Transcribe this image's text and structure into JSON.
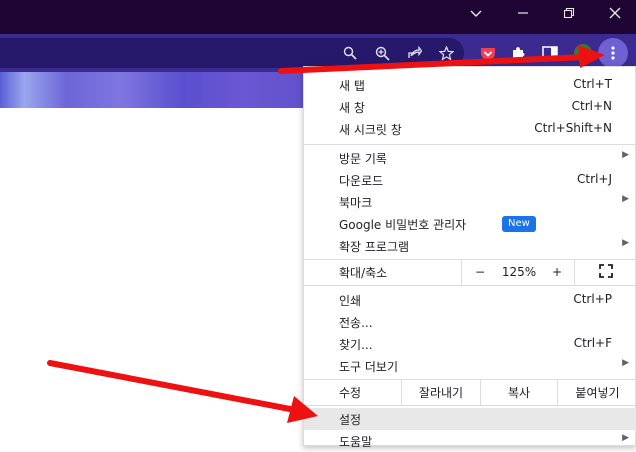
{
  "window_controls": [
    {
      "name": "tab-search",
      "icon": "chevron-down-icon",
      "glyph": "⌵"
    },
    {
      "name": "minimize",
      "icon": "minimize-icon",
      "glyph": "—"
    },
    {
      "name": "restore",
      "icon": "restore-icon",
      "glyph": "❐"
    },
    {
      "name": "close",
      "icon": "close-icon",
      "glyph": "✕"
    }
  ],
  "colors": {
    "titlebar": "#1f0533",
    "toolbar": "#3b2a8f",
    "omnibox": "#26186a",
    "accent_blue": "#1a73e8",
    "arrow_red": "#ee1111",
    "highlight": "#e8e8e9"
  },
  "menu": {
    "group1": [
      {
        "label": "새 탭",
        "shortcut": "Ctrl+T"
      },
      {
        "label": "새 창",
        "shortcut": "Ctrl+N"
      },
      {
        "label": "새 시크릿 창",
        "shortcut": "Ctrl+Shift+N"
      }
    ],
    "group2": [
      {
        "label": "방문 기록",
        "shortcut": "",
        "submenu": "▶"
      },
      {
        "label": "다운로드",
        "shortcut": "Ctrl+J"
      },
      {
        "label": "북마크",
        "shortcut": "",
        "submenu": "▶"
      },
      {
        "label": "Google 비밀번호 관리자",
        "shortcut": "",
        "badge": "New"
      },
      {
        "label": "확장 프로그램",
        "shortcut": "",
        "submenu": "▶"
      }
    ],
    "zoom": {
      "label": "확대/축소",
      "minus": "−",
      "value": "125%",
      "plus": "+",
      "fullscreen": "⛶"
    },
    "group3": [
      {
        "label": "인쇄",
        "shortcut": "Ctrl+P"
      },
      {
        "label": "전송...",
        "shortcut": ""
      },
      {
        "label": "찾기...",
        "shortcut": "Ctrl+F"
      },
      {
        "label": "도구 더보기",
        "shortcut": "",
        "submenu": "▶"
      }
    ],
    "edit": {
      "label": "수정",
      "cut": "잘라내기",
      "copy": "복사",
      "paste": "붙여넣기"
    },
    "group4": [
      {
        "label": "설정",
        "shortcut": ""
      },
      {
        "label": "도움말",
        "shortcut": "",
        "submenu": "▶"
      }
    ]
  }
}
